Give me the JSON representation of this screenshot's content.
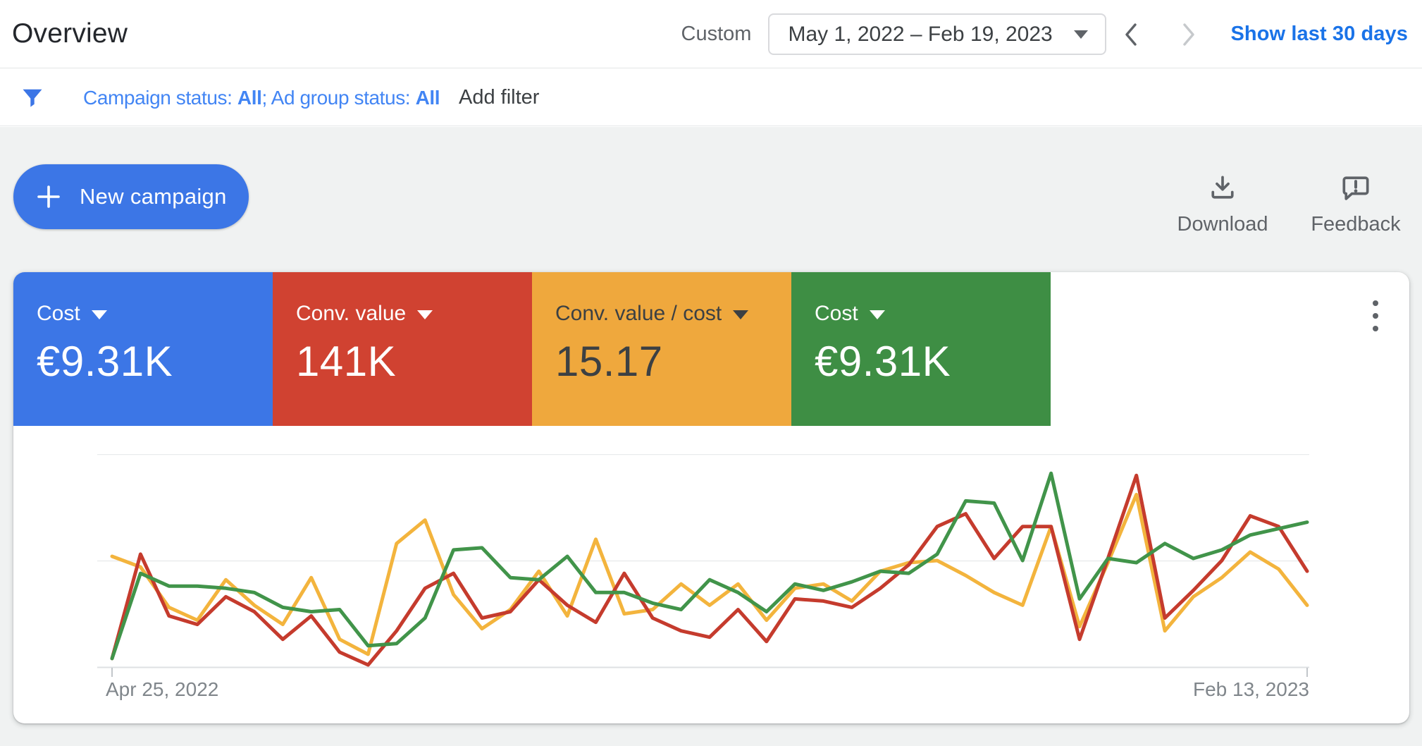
{
  "header": {
    "title": "Overview",
    "date_mode_label": "Custom",
    "date_range": "May 1, 2022 – Feb 19, 2023",
    "show_last_label": "Show last 30 days"
  },
  "filter_bar": {
    "summary_prefix": "Campaign status: ",
    "summary_value1": "All",
    "summary_mid": "; Ad group status: ",
    "summary_value2": "All",
    "add_filter_label": "Add filter"
  },
  "toolbar": {
    "new_campaign_label": "New campaign",
    "download_label": "Download",
    "feedback_label": "Feedback"
  },
  "scorecards": [
    {
      "label": "Cost",
      "value": "€9.31K",
      "bg": "#3c76e6",
      "fg": "#ffffff"
    },
    {
      "label": "Conv. value",
      "value": "141K",
      "bg": "#d04231",
      "fg": "#ffffff"
    },
    {
      "label": "Conv. value / cost",
      "value": "15.17",
      "bg": "#efa83d",
      "fg": "#3c4043"
    },
    {
      "label": "Cost",
      "value": "€9.31K",
      "bg": "#3e8e44",
      "fg": "#ffffff"
    }
  ],
  "colors": {
    "link_blue": "#1a73e8",
    "filter_blue": "#4285f4",
    "button_blue": "#3c76e6",
    "gray_text": "#5f6368",
    "page_gray": "#f0f2f2"
  },
  "chart_data": {
    "type": "line",
    "x_start_label": "Apr 25, 2022",
    "x_end_label": "Feb 13, 2023",
    "x_unit": "week",
    "y_unit": "percent_of_plot_height (no y-axis shown in UI)",
    "grid": "3 horizontal gridlines",
    "legend": "none (colors match scorecards)",
    "series": [
      {
        "name": "Conv. value / cost",
        "color": "#f3b43d",
        "values": [
          52,
          47,
          28,
          22,
          41,
          29,
          20,
          42,
          13,
          6,
          58,
          69,
          34,
          18,
          27,
          45,
          24,
          60,
          25,
          27,
          39,
          29,
          39,
          22,
          37,
          39,
          31,
          45,
          49,
          50,
          43,
          35,
          29,
          66,
          19,
          49,
          81,
          17,
          33,
          42,
          54,
          46,
          29
        ]
      },
      {
        "name": "Conv. value",
        "color": "#c53b2d",
        "values": [
          4,
          53,
          24,
          20,
          33,
          26,
          13,
          24,
          7,
          1,
          17,
          37,
          44,
          23,
          26,
          41,
          29,
          21,
          44,
          23,
          17,
          14,
          27,
          12,
          32,
          31,
          28,
          37,
          48,
          66,
          72,
          51,
          66,
          66,
          13,
          51,
          90,
          23,
          36,
          50,
          71,
          66,
          45
        ]
      },
      {
        "name": "Cost",
        "color": "#41944a",
        "values": [
          4,
          44,
          38,
          38,
          37,
          35,
          28,
          26,
          27,
          10,
          11,
          23,
          55,
          56,
          42,
          41,
          52,
          35,
          35,
          30,
          27,
          41,
          35,
          26,
          39,
          36,
          40,
          45,
          44,
          53,
          78,
          77,
          50,
          91,
          32,
          51,
          49,
          58,
          51,
          55,
          62,
          65,
          68
        ]
      }
    ]
  }
}
